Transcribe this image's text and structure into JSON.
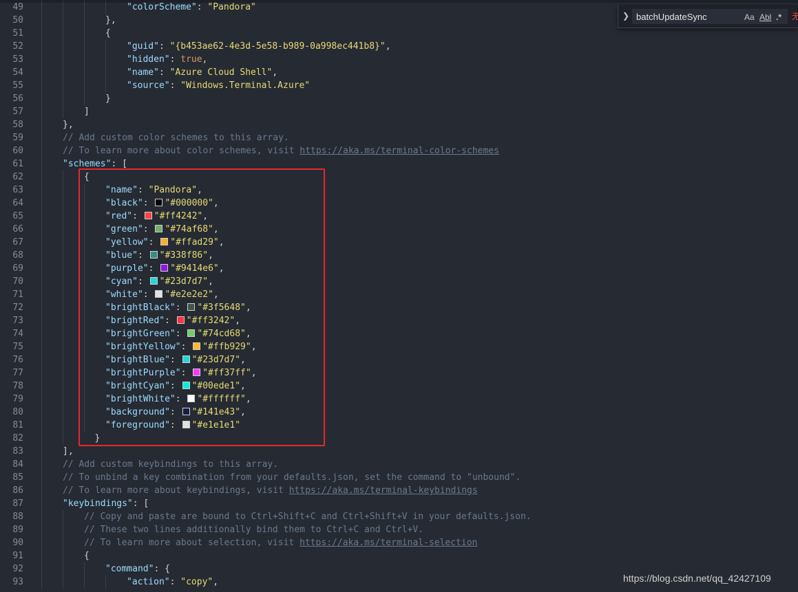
{
  "editor": {
    "lines": [
      {
        "n": "49",
        "indent": 4,
        "seg": [
          {
            "t": "\"colorScheme\"",
            "c": "k"
          },
          {
            "t": ": ",
            "c": "p"
          },
          {
            "t": "\"Pandora\"",
            "c": "s"
          }
        ]
      },
      {
        "n": "50",
        "indent": 3,
        "seg": [
          {
            "t": "},",
            "c": "p"
          }
        ]
      },
      {
        "n": "51",
        "indent": 3,
        "seg": [
          {
            "t": "{",
            "c": "p"
          }
        ]
      },
      {
        "n": "52",
        "indent": 4,
        "seg": [
          {
            "t": "\"guid\"",
            "c": "k"
          },
          {
            "t": ": ",
            "c": "p"
          },
          {
            "t": "\"{b453ae62-4e3d-5e58-b989-0a998ec441b8}\"",
            "c": "s"
          },
          {
            "t": ",",
            "c": "p"
          }
        ]
      },
      {
        "n": "53",
        "indent": 4,
        "seg": [
          {
            "t": "\"hidden\"",
            "c": "k"
          },
          {
            "t": ": ",
            "c": "p"
          },
          {
            "t": "true",
            "c": "b"
          },
          {
            "t": ",",
            "c": "p"
          }
        ]
      },
      {
        "n": "54",
        "indent": 4,
        "seg": [
          {
            "t": "\"name\"",
            "c": "k"
          },
          {
            "t": ": ",
            "c": "p"
          },
          {
            "t": "\"Azure Cloud Shell\"",
            "c": "s"
          },
          {
            "t": ",",
            "c": "p"
          }
        ]
      },
      {
        "n": "55",
        "indent": 4,
        "seg": [
          {
            "t": "\"source\"",
            "c": "k"
          },
          {
            "t": ": ",
            "c": "p"
          },
          {
            "t": "\"Windows.Terminal.Azure\"",
            "c": "s"
          }
        ]
      },
      {
        "n": "56",
        "indent": 3,
        "seg": [
          {
            "t": "}",
            "c": "p"
          }
        ]
      },
      {
        "n": "57",
        "indent": 2,
        "seg": [
          {
            "t": "]",
            "c": "p"
          }
        ]
      },
      {
        "n": "58",
        "indent": 1,
        "seg": [
          {
            "t": "},",
            "c": "p"
          }
        ]
      },
      {
        "n": "59",
        "indent": 1,
        "seg": [
          {
            "t": "// Add custom color schemes to this array.",
            "c": "c"
          }
        ]
      },
      {
        "n": "60",
        "indent": 1,
        "seg": [
          {
            "t": "// To learn more about color schemes, visit ",
            "c": "c"
          },
          {
            "t": "https://aka.ms/terminal-color-schemes",
            "c": "u"
          }
        ]
      },
      {
        "n": "61",
        "indent": 1,
        "seg": [
          {
            "t": "\"schemes\"",
            "c": "k"
          },
          {
            "t": ": [",
            "c": "p"
          }
        ]
      },
      {
        "n": "62",
        "indent": 2,
        "seg": [
          {
            "t": "{",
            "c": "p"
          }
        ]
      },
      {
        "n": "63",
        "indent": 3,
        "seg": [
          {
            "t": "\"name\"",
            "c": "k"
          },
          {
            "t": ": ",
            "c": "p"
          },
          {
            "t": "\"Pandora\"",
            "c": "s"
          },
          {
            "t": ",",
            "c": "p"
          }
        ]
      },
      {
        "n": "64",
        "indent": 3,
        "seg": [
          {
            "t": "\"black\"",
            "c": "k"
          },
          {
            "t": ": ",
            "c": "p"
          },
          {
            "sw": "#000000"
          },
          {
            "t": "\"#000000\"",
            "c": "s"
          },
          {
            "t": ",",
            "c": "p"
          }
        ]
      },
      {
        "n": "65",
        "indent": 3,
        "seg": [
          {
            "t": "\"red\"",
            "c": "k"
          },
          {
            "t": ": ",
            "c": "p"
          },
          {
            "sw": "#ff4242"
          },
          {
            "t": "\"#ff4242\"",
            "c": "s"
          },
          {
            "t": ",",
            "c": "p"
          }
        ]
      },
      {
        "n": "66",
        "indent": 3,
        "seg": [
          {
            "t": "\"green\"",
            "c": "k"
          },
          {
            "t": ": ",
            "c": "p"
          },
          {
            "sw": "#74af68"
          },
          {
            "t": "\"#74af68\"",
            "c": "s"
          },
          {
            "t": ",",
            "c": "p"
          }
        ]
      },
      {
        "n": "67",
        "indent": 3,
        "seg": [
          {
            "t": "\"yellow\"",
            "c": "k"
          },
          {
            "t": ": ",
            "c": "p"
          },
          {
            "sw": "#ffad29"
          },
          {
            "t": "\"#ffad29\"",
            "c": "s"
          },
          {
            "t": ",",
            "c": "p"
          }
        ]
      },
      {
        "n": "68",
        "indent": 3,
        "seg": [
          {
            "t": "\"blue\"",
            "c": "k"
          },
          {
            "t": ": ",
            "c": "p"
          },
          {
            "sw": "#338f86"
          },
          {
            "t": "\"#338f86\"",
            "c": "s"
          },
          {
            "t": ",",
            "c": "p"
          }
        ]
      },
      {
        "n": "69",
        "indent": 3,
        "seg": [
          {
            "t": "\"purple\"",
            "c": "k"
          },
          {
            "t": ": ",
            "c": "p"
          },
          {
            "sw": "#9414e6"
          },
          {
            "t": "\"#9414e6\"",
            "c": "s"
          },
          {
            "t": ",",
            "c": "p"
          }
        ]
      },
      {
        "n": "70",
        "indent": 3,
        "seg": [
          {
            "t": "\"cyan\"",
            "c": "k"
          },
          {
            "t": ": ",
            "c": "p"
          },
          {
            "sw": "#23d7d7"
          },
          {
            "t": "\"#23d7d7\"",
            "c": "s"
          },
          {
            "t": ",",
            "c": "p"
          }
        ]
      },
      {
        "n": "71",
        "indent": 3,
        "seg": [
          {
            "t": "\"white\"",
            "c": "k"
          },
          {
            "t": ": ",
            "c": "p"
          },
          {
            "sw": "#e2e2e2"
          },
          {
            "t": "\"#e2e2e2\"",
            "c": "s"
          },
          {
            "t": ",",
            "c": "p"
          }
        ]
      },
      {
        "n": "72",
        "indent": 3,
        "seg": [
          {
            "t": "\"brightBlack\"",
            "c": "k"
          },
          {
            "t": ": ",
            "c": "p"
          },
          {
            "sw": "#3f5648"
          },
          {
            "t": "\"#3f5648\"",
            "c": "s"
          },
          {
            "t": ",",
            "c": "p"
          }
        ]
      },
      {
        "n": "73",
        "indent": 3,
        "seg": [
          {
            "t": "\"brightRed\"",
            "c": "k"
          },
          {
            "t": ": ",
            "c": "p"
          },
          {
            "sw": "#ff3242"
          },
          {
            "t": "\"#ff3242\"",
            "c": "s"
          },
          {
            "t": ",",
            "c": "p"
          }
        ]
      },
      {
        "n": "74",
        "indent": 3,
        "seg": [
          {
            "t": "\"brightGreen\"",
            "c": "k"
          },
          {
            "t": ": ",
            "c": "p"
          },
          {
            "sw": "#74cd68"
          },
          {
            "t": "\"#74cd68\"",
            "c": "s"
          },
          {
            "t": ",",
            "c": "p"
          }
        ]
      },
      {
        "n": "75",
        "indent": 3,
        "seg": [
          {
            "t": "\"brightYellow\"",
            "c": "k"
          },
          {
            "t": ": ",
            "c": "p"
          },
          {
            "sw": "#ffb929"
          },
          {
            "t": "\"#ffb929\"",
            "c": "s"
          },
          {
            "t": ",",
            "c": "p"
          }
        ]
      },
      {
        "n": "76",
        "indent": 3,
        "seg": [
          {
            "t": "\"brightBlue\"",
            "c": "k"
          },
          {
            "t": ": ",
            "c": "p"
          },
          {
            "sw": "#23d7d7"
          },
          {
            "t": "\"#23d7d7\"",
            "c": "s"
          },
          {
            "t": ",",
            "c": "p"
          }
        ]
      },
      {
        "n": "77",
        "indent": 3,
        "seg": [
          {
            "t": "\"brightPurple\"",
            "c": "k"
          },
          {
            "t": ": ",
            "c": "p"
          },
          {
            "sw": "#ff37ff"
          },
          {
            "t": "\"#ff37ff\"",
            "c": "s"
          },
          {
            "t": ",",
            "c": "p"
          }
        ]
      },
      {
        "n": "78",
        "indent": 3,
        "seg": [
          {
            "t": "\"brightCyan\"",
            "c": "k"
          },
          {
            "t": ": ",
            "c": "p"
          },
          {
            "sw": "#00ede1"
          },
          {
            "t": "\"#00ede1\"",
            "c": "s"
          },
          {
            "t": ",",
            "c": "p"
          }
        ]
      },
      {
        "n": "79",
        "indent": 3,
        "seg": [
          {
            "t": "\"brightWhite\"",
            "c": "k"
          },
          {
            "t": ": ",
            "c": "p"
          },
          {
            "sw": "#ffffff"
          },
          {
            "t": "\"#ffffff\"",
            "c": "s"
          },
          {
            "t": ",",
            "c": "p"
          }
        ]
      },
      {
        "n": "80",
        "indent": 3,
        "seg": [
          {
            "t": "\"background\"",
            "c": "k"
          },
          {
            "t": ": ",
            "c": "p"
          },
          {
            "sw": "#141e43"
          },
          {
            "t": "\"#141e43\"",
            "c": "s"
          },
          {
            "t": ",",
            "c": "p"
          }
        ]
      },
      {
        "n": "81",
        "indent": 3,
        "seg": [
          {
            "t": "\"foreground\"",
            "c": "k"
          },
          {
            "t": ": ",
            "c": "p"
          },
          {
            "sw": "#e1e1e1"
          },
          {
            "t": "\"#e1e1e1\"",
            "c": "s"
          }
        ]
      },
      {
        "n": "82",
        "indent": 2.5,
        "seg": [
          {
            "t": "}",
            "c": "p"
          }
        ]
      },
      {
        "n": "83",
        "indent": 1,
        "seg": [
          {
            "t": "],",
            "c": "p"
          }
        ]
      },
      {
        "n": "84",
        "indent": 1,
        "seg": [
          {
            "t": "// Add custom keybindings to this array.",
            "c": "c"
          }
        ]
      },
      {
        "n": "85",
        "indent": 1,
        "seg": [
          {
            "t": "// To unbind a key combination from your defaults.json, set the command to \"unbound\".",
            "c": "c"
          }
        ]
      },
      {
        "n": "86",
        "indent": 1,
        "seg": [
          {
            "t": "// To learn more about keybindings, visit ",
            "c": "c"
          },
          {
            "t": "https://aka.ms/terminal-keybindings",
            "c": "u"
          }
        ]
      },
      {
        "n": "87",
        "indent": 1,
        "seg": [
          {
            "t": "\"keybindings\"",
            "c": "k"
          },
          {
            "t": ": [",
            "c": "p"
          }
        ]
      },
      {
        "n": "88",
        "indent": 2,
        "seg": [
          {
            "t": "// Copy and paste are bound to Ctrl+Shift+C and Ctrl+Shift+V in your defaults.json.",
            "c": "c"
          }
        ]
      },
      {
        "n": "89",
        "indent": 2,
        "seg": [
          {
            "t": "// These two lines additionally bind them to Ctrl+C and Ctrl+V.",
            "c": "c"
          }
        ]
      },
      {
        "n": "90",
        "indent": 2,
        "seg": [
          {
            "t": "// To learn more about selection, visit ",
            "c": "c"
          },
          {
            "t": "https://aka.ms/terminal-selection",
            "c": "u"
          }
        ]
      },
      {
        "n": "91",
        "indent": 2,
        "seg": [
          {
            "t": "{",
            "c": "p"
          }
        ]
      },
      {
        "n": "92",
        "indent": 3,
        "seg": [
          {
            "t": "\"command\"",
            "c": "k"
          },
          {
            "t": ": {",
            "c": "p"
          }
        ]
      },
      {
        "n": "93",
        "indent": 4,
        "seg": [
          {
            "t": "\"action\"",
            "c": "k"
          },
          {
            "t": ": ",
            "c": "p"
          },
          {
            "t": "\"copy\"",
            "c": "s"
          },
          {
            "t": ",",
            "c": "p"
          }
        ]
      }
    ]
  },
  "find_widget": {
    "query": "batchUpdateSync",
    "match_case_label": "Aa",
    "whole_word_label": "Abl",
    "regex_label": ".*",
    "no_results_label": "无"
  },
  "watermark": {
    "text": "https://blog.csdn.net/qq_42427109"
  }
}
